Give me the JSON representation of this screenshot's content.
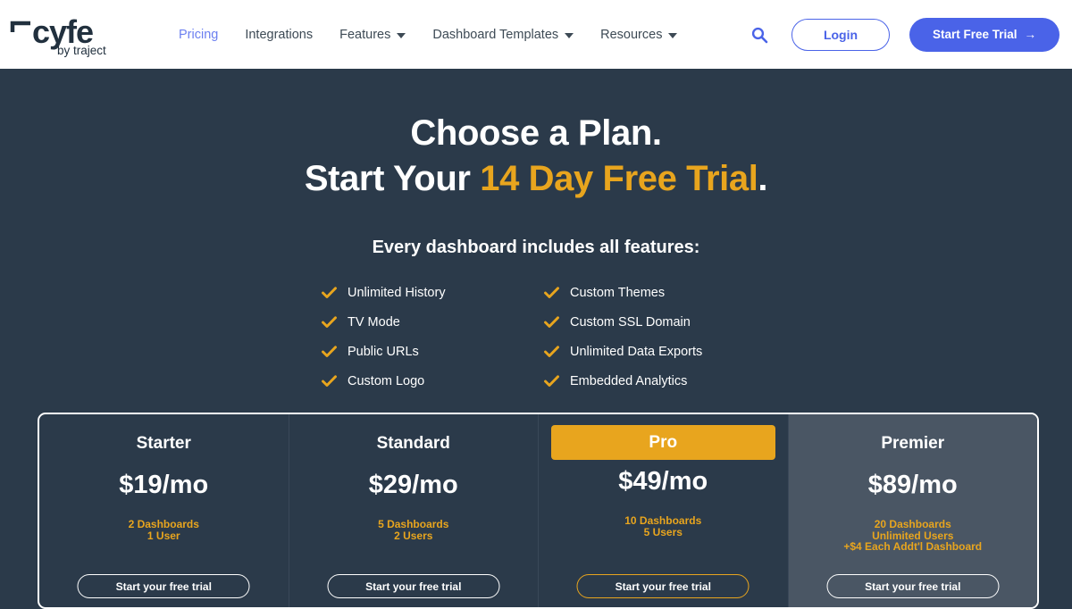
{
  "brand": {
    "name": "cyfe",
    "tagline": "by traject"
  },
  "nav": {
    "links": [
      {
        "label": "Pricing",
        "active": true,
        "dropdown": false
      },
      {
        "label": "Integrations",
        "active": false,
        "dropdown": false
      },
      {
        "label": "Features",
        "active": false,
        "dropdown": true
      },
      {
        "label": "Dashboard Templates",
        "active": false,
        "dropdown": true
      },
      {
        "label": "Resources",
        "active": false,
        "dropdown": true
      }
    ],
    "search_icon": "search-icon",
    "login_label": "Login",
    "trial_label": "Start Free Trial",
    "trial_arrow": "→"
  },
  "hero": {
    "line1": "Choose a Plan.",
    "line2_prefix": "Start Your ",
    "line2_accent": "14 Day Free Trial",
    "line2_suffix": ".",
    "subtitle": "Every dashboard includes all features:"
  },
  "features": [
    "Unlimited History",
    "Custom Themes",
    "TV Mode",
    "Custom SSL Domain",
    "Public URLs",
    "Unlimited Data Exports",
    "Custom Logo",
    "Embedded Analytics"
  ],
  "plans": [
    {
      "name": "Starter",
      "price": "$19/mo",
      "details": [
        "2 Dashboards",
        "1 User"
      ],
      "cta": "Start your free trial",
      "highlighted": false
    },
    {
      "name": "Standard",
      "price": "$29/mo",
      "details": [
        "5 Dashboards",
        "2 Users"
      ],
      "cta": "Start your free trial",
      "highlighted": false
    },
    {
      "name": "Pro",
      "price": "$49/mo",
      "details": [
        "10 Dashboards",
        "5 Users"
      ],
      "cta": "Start your free trial",
      "highlighted": true
    },
    {
      "name": "Premier",
      "price": "$89/mo",
      "details": [
        "20 Dashboards",
        "Unlimited Users",
        "+$4 Each Addt'l Dashboard"
      ],
      "cta": "Start your free trial",
      "highlighted": false
    }
  ],
  "colors": {
    "page_bg": "#2b3a4a",
    "accent_gold": "#e8a51e",
    "brand_blue": "#4a63e8",
    "nav_bg": "#ffffff",
    "premier_bg": "#4a5664"
  }
}
